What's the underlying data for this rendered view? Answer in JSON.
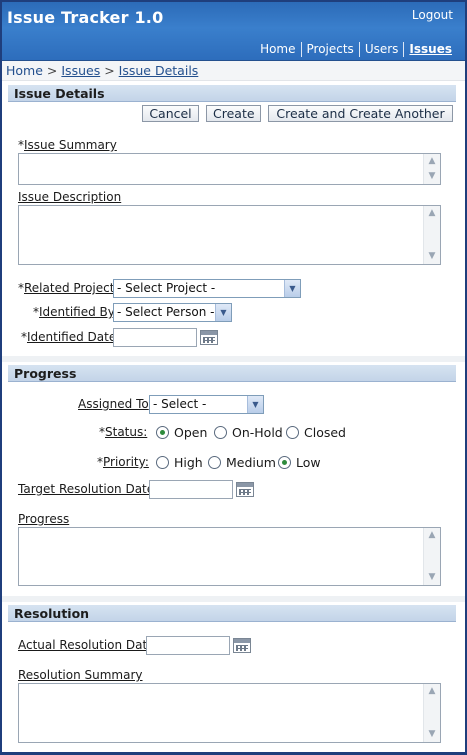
{
  "header": {
    "app_title": "Issue Tracker 1.0",
    "logout_label": "Logout",
    "nav": [
      {
        "label": "Home"
      },
      {
        "label": "Projects"
      },
      {
        "label": "Users"
      },
      {
        "label": "Issues"
      }
    ]
  },
  "breadcrumb": {
    "home": "Home",
    "sep1": ">",
    "issues": "Issues",
    "sep2": ">",
    "current": "Issue Details"
  },
  "issue_details": {
    "heading": "Issue Details",
    "cancel_label": "Cancel",
    "create_label": "Create",
    "create_another_label": "Create and Create Another",
    "required_mark": "*",
    "summary_label": "Issue Summary",
    "description_label": "Issue Description",
    "related_project_label": "Related Project",
    "related_project_value": "- Select Project -",
    "identified_by_label": "Identified By",
    "identified_by_value": "- Select Person -",
    "identified_date_label": "Identified Date"
  },
  "progress": {
    "heading": "Progress",
    "assigned_to_label": "Assigned To",
    "assigned_to_value": "- Select -",
    "required_mark": "*",
    "status_label": "Status:",
    "status_options": [
      "Open",
      "On-Hold",
      "Closed"
    ],
    "status_selected": "Open",
    "priority_label": "Priority:",
    "priority_options": [
      "High",
      "Medium",
      "Low"
    ],
    "priority_selected": "Low",
    "target_resolution_date_label": "Target Resolution Date",
    "progress_label": "Progress"
  },
  "resolution": {
    "heading": "Resolution",
    "actual_resolution_date_label": "Actual Resolution Date",
    "resolution_summary_label": "Resolution Summary"
  },
  "colors": {
    "header_blue": "#2c6bb8",
    "section_head": "#c3d4e8",
    "link_blue": "#23508e",
    "radio_checked": "#2e8b3c"
  }
}
